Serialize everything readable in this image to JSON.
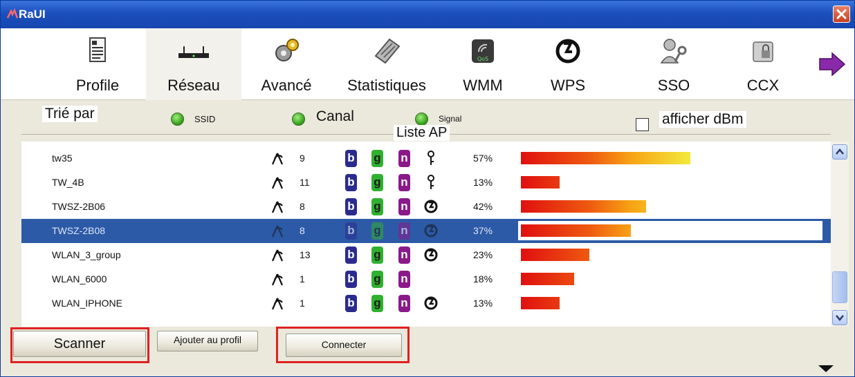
{
  "window": {
    "title": "RaUI",
    "app_icon": "raui-logo-icon",
    "close_icon": "close-icon"
  },
  "toolbar": {
    "items": [
      {
        "label": "Profile",
        "icon": "profile-document-icon"
      },
      {
        "label": "Réseau",
        "icon": "router-icon",
        "selected": true
      },
      {
        "label": "Avancé",
        "icon": "gears-icon"
      },
      {
        "label": "Statistiques",
        "icon": "calculator-icon"
      },
      {
        "label": "WMM",
        "icon": "qos-icon"
      },
      {
        "label": "WPS",
        "icon": "wps-icon"
      },
      {
        "label": "SSO",
        "icon": "user-key-icon"
      },
      {
        "label": "CCX",
        "icon": "ccx-lock-folder-icon"
      }
    ],
    "next_icon": "arrow-right-icon"
  },
  "sort": {
    "label": "Trié par",
    "options": [
      {
        "label": "SSID",
        "selected": false
      },
      {
        "label": "Canal",
        "selected": true
      },
      {
        "label": "Signal",
        "selected": false
      }
    ],
    "show_dbm_label": "afficher dBm",
    "show_dbm_checked": false
  },
  "list": {
    "title": "Liste AP",
    "rows": [
      {
        "ssid": "tw35",
        "channel": "9",
        "b": true,
        "g": true,
        "n": true,
        "security": "key-icon",
        "signal": "57%",
        "signal_value": 0.57
      },
      {
        "ssid": "TW_4B",
        "channel": "11",
        "b": true,
        "g": true,
        "n": true,
        "security": "key-icon",
        "signal": "13%",
        "signal_value": 0.13
      },
      {
        "ssid": "TWSZ-2B06",
        "channel": "8",
        "b": true,
        "g": true,
        "n": true,
        "security": "wps-icon",
        "signal": "42%",
        "signal_value": 0.42
      },
      {
        "ssid": "TWSZ-2B08",
        "channel": "8",
        "b": true,
        "g": true,
        "n": true,
        "security": "wps-icon",
        "signal": "37%",
        "signal_value": 0.37,
        "selected": true
      },
      {
        "ssid": "WLAN_3_group",
        "channel": "13",
        "b": true,
        "g": true,
        "n": true,
        "security": "wps-icon",
        "signal": "23%",
        "signal_value": 0.23
      },
      {
        "ssid": "WLAN_6000",
        "channel": "1",
        "b": true,
        "g": true,
        "n": true,
        "security": "",
        "signal": "18%",
        "signal_value": 0.18
      },
      {
        "ssid": "WLAN_IPHONE",
        "channel": "1",
        "b": true,
        "g": true,
        "n": true,
        "security": "wps-icon",
        "signal": "13%",
        "signal_value": 0.13
      }
    ]
  },
  "buttons": {
    "scan": "Scanner",
    "add_profile": "Ajouter au profil",
    "connect": "Connecter"
  },
  "badge_letters": {
    "b": "b",
    "g": "g",
    "n": "n"
  }
}
